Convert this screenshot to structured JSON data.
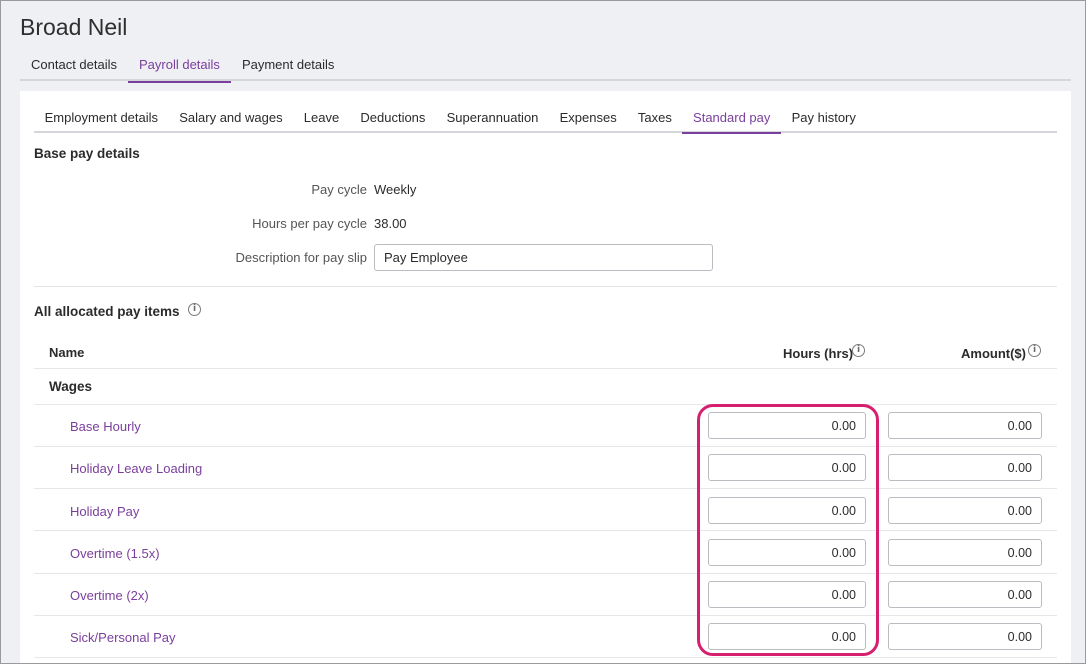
{
  "page": {
    "title": "Broad Neil"
  },
  "top_tabs": [
    {
      "label": "Contact details",
      "active": false
    },
    {
      "label": "Payroll details",
      "active": true
    },
    {
      "label": "Payment details",
      "active": false
    }
  ],
  "sub_tabs": [
    {
      "label": "Employment details",
      "active": false
    },
    {
      "label": "Salary and wages",
      "active": false
    },
    {
      "label": "Leave",
      "active": false
    },
    {
      "label": "Deductions",
      "active": false
    },
    {
      "label": "Superannuation",
      "active": false
    },
    {
      "label": "Expenses",
      "active": false
    },
    {
      "label": "Taxes",
      "active": false
    },
    {
      "label": "Standard pay",
      "active": true
    },
    {
      "label": "Pay history",
      "active": false
    }
  ],
  "base_pay": {
    "title": "Base pay details",
    "pay_cycle_label": "Pay cycle",
    "pay_cycle_value": "Weekly",
    "hours_label": "Hours per pay cycle",
    "hours_value": "38.00",
    "description_label": "Description for pay slip",
    "description_value": "Pay Employee"
  },
  "pay_items": {
    "title": "All allocated pay items",
    "col_name": "Name",
    "col_hours": "Hours (hrs)",
    "col_amount": "Amount($)",
    "group": "Wages",
    "rows": [
      {
        "name": "Base Hourly",
        "hours": "0.00",
        "amount": "0.00"
      },
      {
        "name": "Holiday Leave Loading",
        "hours": "0.00",
        "amount": "0.00"
      },
      {
        "name": "Holiday Pay",
        "hours": "0.00",
        "amount": "0.00"
      },
      {
        "name": "Overtime (1.5x)",
        "hours": "0.00",
        "amount": "0.00"
      },
      {
        "name": "Overtime (2x)",
        "hours": "0.00",
        "amount": "0.00"
      },
      {
        "name": "Sick/Personal Pay",
        "hours": "0.00",
        "amount": "0.00"
      }
    ]
  },
  "colors": {
    "accent": "#7a3f9d",
    "highlight": "#d6206f"
  },
  "icons": {
    "info": "info-icon"
  }
}
